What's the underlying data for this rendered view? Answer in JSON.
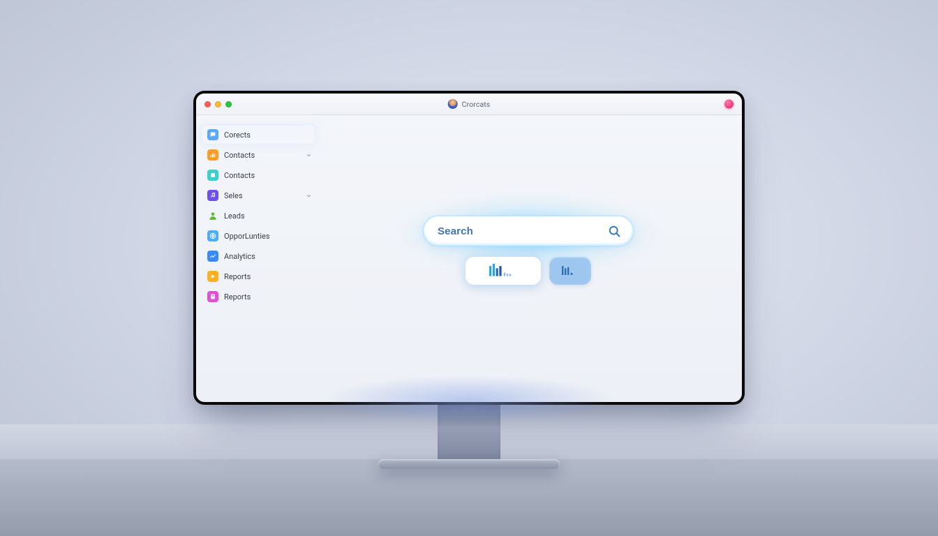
{
  "window": {
    "title": "Crorcats"
  },
  "sidebar": {
    "items": [
      {
        "label": "Corects",
        "icon": "message-icon",
        "tint": "ic-0",
        "expandable": false
      },
      {
        "label": "Contacts",
        "icon": "chart-icon",
        "tint": "ic-1",
        "expandable": true
      },
      {
        "label": "Contacts",
        "icon": "app-icon",
        "tint": "ic-2",
        "expandable": false
      },
      {
        "label": "Seles",
        "icon": "music-icon",
        "tint": "ic-3",
        "expandable": true
      },
      {
        "label": "Leads",
        "icon": "person-icon",
        "tint": "ic-4",
        "expandable": false
      },
      {
        "label": "OpporLunties",
        "icon": "globe-icon",
        "tint": "ic-5",
        "expandable": false
      },
      {
        "label": "Analytics",
        "icon": "analytics-icon",
        "tint": "ic-6",
        "expandable": false
      },
      {
        "label": "Reports",
        "icon": "play-icon",
        "tint": "ic-7",
        "expandable": false
      },
      {
        "label": "Reports",
        "icon": "note-icon",
        "tint": "ic-8",
        "expandable": false
      }
    ]
  },
  "search": {
    "placeholder": "Search"
  },
  "chips": [
    {
      "name": "chart-chip-a"
    },
    {
      "name": "chart-chip-b"
    }
  ],
  "colors": {
    "accent_cyan": "#59c8ff",
    "accent_blue": "#3a7bc8",
    "notif": "#e11d6b"
  }
}
